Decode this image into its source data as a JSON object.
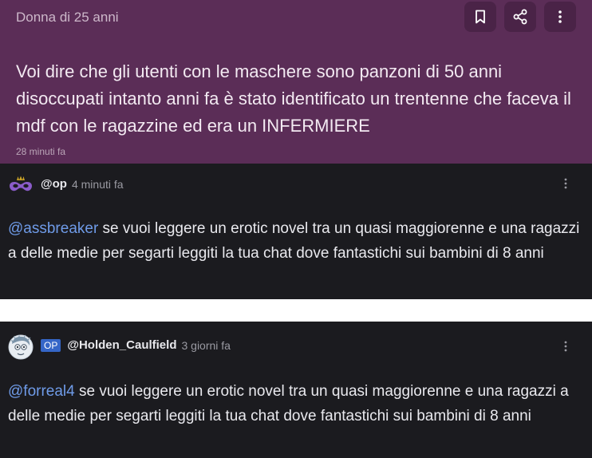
{
  "post": {
    "author": "Donna di 25 anni",
    "body": "Voi dire che gli utenti con le maschere sono panzoni di 50 anni disoccupati intanto anni fa è stato identificato un trentenne che faceva il mdf con le ragazzine ed era un INFERMIERE",
    "time": "28 minuti fa",
    "actions": [
      "bookmark-icon",
      "share-icon",
      "more-icon"
    ],
    "colors": {
      "background": "#5b2d57",
      "button": "#4a2347"
    }
  },
  "comments": [
    {
      "avatar": "mask-icon",
      "username": "@op",
      "time": "4 minuti fa",
      "mention": "@assbreaker",
      "text": " se vuoi leggere un erotic novel tra un quasi maggiorenne e una ragazzi a delle medie per segarti leggiti la tua chat dove fantastichi sui bambini di 8 anni"
    },
    {
      "avatar": "drawn-face-icon",
      "badge": "OP",
      "username": "@Holden_Caulfield",
      "time": "3 giorni fa",
      "mention": "@forreal4",
      "text": " se vuoi leggere un erotic novel tra un quasi maggiorenne e una ragazzi a delle medie per segarti leggiti la tua chat dove fantastichi sui bambini di 8 anni"
    }
  ]
}
